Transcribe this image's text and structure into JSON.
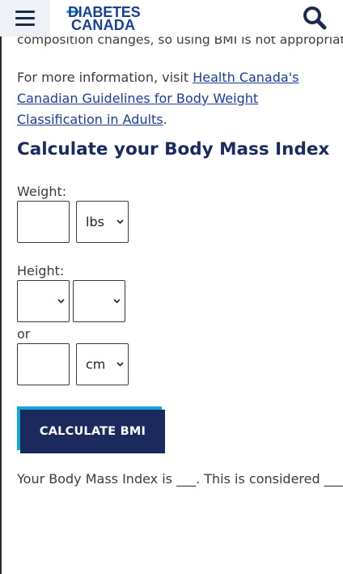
{
  "header": {
    "menu_icon": "hamburger-menu-icon",
    "logo_line1": "DIABETES",
    "logo_line2": "CANADA",
    "search_icon": "search-icon",
    "accent_color": "#f0c419",
    "brand_color": "#1b2a5c"
  },
  "content": {
    "cut_off_text": "composition changes, so using BMI is not appropriate.",
    "info_prefix": "For more information, visit ",
    "info_link": "Health Canada's Canadian Guidelines for Body Weight Classification in Adults",
    "info_suffix": ".",
    "title": "Calculate your Body Mass Index"
  },
  "form": {
    "weight_label": "Weight:",
    "weight_value": "",
    "weight_unit": "lbs",
    "height_label": "Height:",
    "height_feet": "",
    "height_inches": "",
    "or_label": "or",
    "height_value": "",
    "height_unit": "cm",
    "calculate_label": "CALCULATE BMI",
    "button_accent": "#16a5d8"
  },
  "result": {
    "text": "Your Body Mass Index is ___. This is considered ____."
  }
}
